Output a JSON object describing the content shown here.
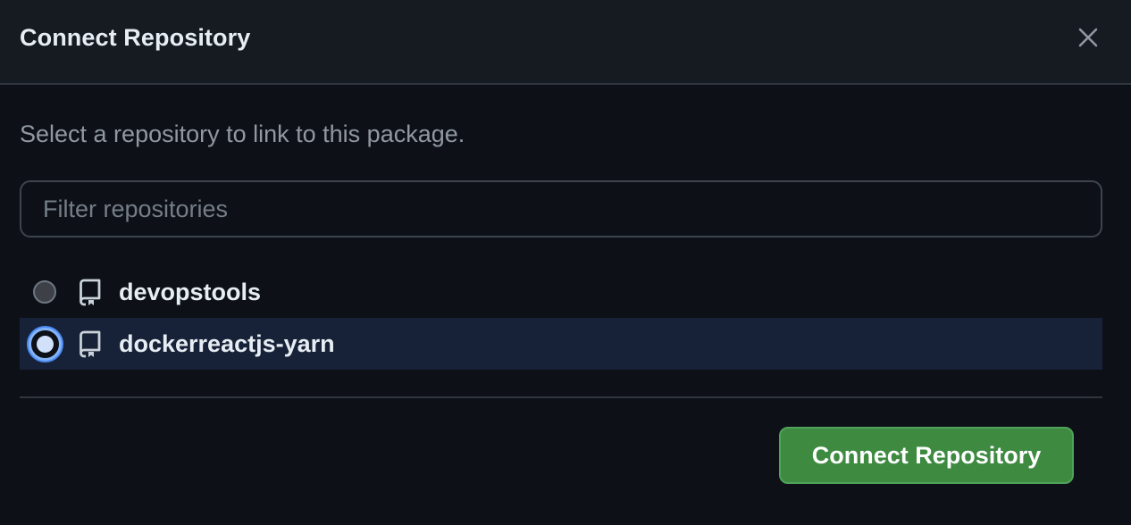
{
  "dialog": {
    "title": "Connect Repository",
    "close_icon": "close-icon",
    "description": "Select a repository to link to this package.",
    "filter": {
      "value": "",
      "placeholder": "Filter repositories"
    },
    "repositories": [
      {
        "name": "devopstools",
        "selected": false,
        "icon": "repo-icon"
      },
      {
        "name": "dockerreactjs-yarn",
        "selected": true,
        "icon": "repo-icon"
      }
    ],
    "connect_button_label": "Connect Repository"
  },
  "colors": {
    "background": "#0d1117",
    "header_background": "#161b22",
    "selected_row": "#172238",
    "accent_blue": "#4c8bf5",
    "button_green": "#3d8a40"
  }
}
